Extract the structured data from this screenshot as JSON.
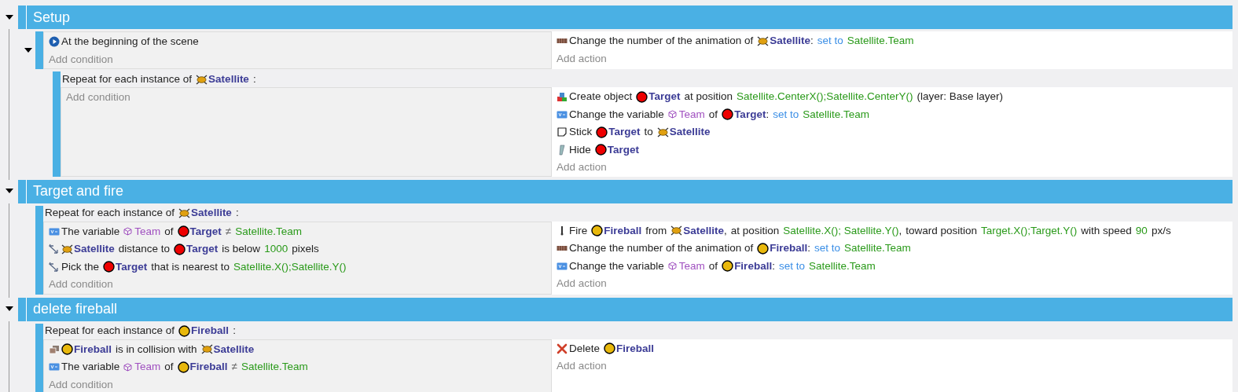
{
  "groups": [
    {
      "title": "Setup",
      "expanded": true,
      "events": [
        {
          "kind": "standard",
          "expanded": true,
          "conditions": [
            {
              "kind": "scene-start",
              "parts": [
                {
                  "kind": "text",
                  "text": "At the beginning of the scene"
                }
              ]
            }
          ],
          "add_condition": "Add condition",
          "actions": [
            {
              "kind": "animation",
              "parts": [
                {
                  "kind": "text",
                  "text": "Change the number of the animation of"
                },
                {
                  "kind": "satellite",
                  "text": "Satellite"
                },
                {
                  "kind": "punct",
                  "text": ":"
                },
                {
                  "kind": "op",
                  "text": "set to"
                },
                {
                  "kind": "param",
                  "text": "Satellite.Team"
                }
              ]
            }
          ],
          "add_action": "Add action",
          "children": [
            {
              "kind": "foreach",
              "header": [
                {
                  "kind": "text",
                  "text": "Repeat for each instance of"
                },
                {
                  "kind": "satellite",
                  "text": "Satellite"
                },
                {
                  "kind": "text",
                  "text": ":"
                }
              ],
              "add_condition": "Add condition",
              "actions": [
                {
                  "kind": "create",
                  "parts": [
                    {
                      "kind": "text",
                      "text": "Create object"
                    },
                    {
                      "kind": "target",
                      "text": "Target"
                    },
                    {
                      "kind": "text",
                      "text": "at position"
                    },
                    {
                      "kind": "param",
                      "text": "Satellite.CenterX();Satellite.CenterY()"
                    },
                    {
                      "kind": "text",
                      "text": "(layer: Base layer)"
                    }
                  ]
                },
                {
                  "kind": "variable",
                  "parts": [
                    {
                      "kind": "text",
                      "text": "Change the variable"
                    },
                    {
                      "kind": "var",
                      "text": "Team"
                    },
                    {
                      "kind": "text",
                      "text": "of"
                    },
                    {
                      "kind": "target",
                      "text": "Target"
                    },
                    {
                      "kind": "punct",
                      "text": ":"
                    },
                    {
                      "kind": "op",
                      "text": "set to"
                    },
                    {
                      "kind": "param",
                      "text": "Satellite.Team"
                    }
                  ]
                },
                {
                  "kind": "stick",
                  "parts": [
                    {
                      "kind": "text",
                      "text": "Stick"
                    },
                    {
                      "kind": "target",
                      "text": "Target"
                    },
                    {
                      "kind": "text",
                      "text": "to"
                    },
                    {
                      "kind": "satellite",
                      "text": "Satellite"
                    }
                  ]
                },
                {
                  "kind": "hide",
                  "parts": [
                    {
                      "kind": "text",
                      "text": "Hide"
                    },
                    {
                      "kind": "target",
                      "text": "Target"
                    }
                  ]
                }
              ],
              "add_action": "Add action"
            }
          ]
        }
      ]
    },
    {
      "title": "Target and fire",
      "expanded": true,
      "events": [
        {
          "kind": "foreach",
          "header": [
            {
              "kind": "text",
              "text": "Repeat for each instance of"
            },
            {
              "kind": "satellite",
              "text": "Satellite"
            },
            {
              "kind": "text",
              "text": ":"
            }
          ],
          "conditions": [
            {
              "kind": "variable",
              "parts": [
                {
                  "kind": "text",
                  "text": "The variable"
                },
                {
                  "kind": "var",
                  "text": "Team"
                },
                {
                  "kind": "text",
                  "text": "of"
                },
                {
                  "kind": "target",
                  "text": "Target"
                },
                {
                  "kind": "operator",
                  "text": "≠"
                },
                {
                  "kind": "param",
                  "text": "Satellite.Team"
                }
              ]
            },
            {
              "kind": "distance",
              "parts": [
                {
                  "kind": "satellite",
                  "text": "Satellite"
                },
                {
                  "kind": "text",
                  "text": "distance to"
                },
                {
                  "kind": "target",
                  "text": "Target"
                },
                {
                  "kind": "text",
                  "text": "is below"
                },
                {
                  "kind": "param",
                  "text": "1000"
                },
                {
                  "kind": "text",
                  "text": "pixels"
                }
              ]
            },
            {
              "kind": "distance",
              "parts": [
                {
                  "kind": "text",
                  "text": "Pick the"
                },
                {
                  "kind": "target",
                  "text": "Target"
                },
                {
                  "kind": "text",
                  "text": "that is nearest to"
                },
                {
                  "kind": "param",
                  "text": "Satellite.X();Satellite.Y()"
                }
              ]
            }
          ],
          "add_condition": "Add condition",
          "actions": [
            {
              "kind": "fire",
              "parts": [
                {
                  "kind": "text",
                  "text": "Fire"
                },
                {
                  "kind": "fireball",
                  "text": "Fireball"
                },
                {
                  "kind": "text",
                  "text": "from"
                },
                {
                  "kind": "satellite",
                  "text": "Satellite"
                },
                {
                  "kind": "punct",
                  "text": ","
                },
                {
                  "kind": "text",
                  "text": "at position"
                },
                {
                  "kind": "param",
                  "text": "Satellite.X(); Satellite.Y()"
                },
                {
                  "kind": "punct",
                  "text": ","
                },
                {
                  "kind": "text",
                  "text": "toward position"
                },
                {
                  "kind": "param",
                  "text": "Target.X();Target.Y()"
                },
                {
                  "kind": "text",
                  "text": "with speed"
                },
                {
                  "kind": "param",
                  "text": "90"
                },
                {
                  "kind": "text",
                  "text": "px/s"
                }
              ]
            },
            {
              "kind": "animation",
              "parts": [
                {
                  "kind": "text",
                  "text": "Change the number of the animation of"
                },
                {
                  "kind": "fireball",
                  "text": "Fireball"
                },
                {
                  "kind": "punct",
                  "text": ":"
                },
                {
                  "kind": "op",
                  "text": "set to"
                },
                {
                  "kind": "param",
                  "text": "Satellite.Team"
                }
              ]
            },
            {
              "kind": "variable",
              "parts": [
                {
                  "kind": "text",
                  "text": "Change the variable"
                },
                {
                  "kind": "var",
                  "text": "Team"
                },
                {
                  "kind": "text",
                  "text": "of"
                },
                {
                  "kind": "fireball",
                  "text": "Fireball"
                },
                {
                  "kind": "punct",
                  "text": ":"
                },
                {
                  "kind": "op",
                  "text": "set to"
                },
                {
                  "kind": "param",
                  "text": "Satellite.Team"
                }
              ]
            }
          ],
          "add_action": "Add action"
        }
      ]
    },
    {
      "title": "delete fireball",
      "expanded": true,
      "events": [
        {
          "kind": "foreach",
          "header": [
            {
              "kind": "text",
              "text": "Repeat for each instance of"
            },
            {
              "kind": "fireball",
              "text": "Fireball"
            },
            {
              "kind": "text",
              "text": ":"
            }
          ],
          "conditions": [
            {
              "kind": "collision",
              "parts": [
                {
                  "kind": "fireball",
                  "text": "Fireball"
                },
                {
                  "kind": "text",
                  "text": "is in collision with"
                },
                {
                  "kind": "satellite",
                  "text": "Satellite"
                }
              ]
            },
            {
              "kind": "variable",
              "parts": [
                {
                  "kind": "text",
                  "text": "The variable"
                },
                {
                  "kind": "var",
                  "text": "Team"
                },
                {
                  "kind": "text",
                  "text": "of"
                },
                {
                  "kind": "fireball",
                  "text": "Fireball"
                },
                {
                  "kind": "operator",
                  "text": "≠"
                },
                {
                  "kind": "param",
                  "text": "Satellite.Team"
                }
              ]
            }
          ],
          "add_condition": "Add condition",
          "actions": [
            {
              "kind": "delete",
              "parts": [
                {
                  "kind": "text",
                  "text": "Delete"
                },
                {
                  "kind": "fireball",
                  "text": "Fireball"
                }
              ]
            }
          ],
          "add_action": "Add action"
        }
      ]
    }
  ]
}
